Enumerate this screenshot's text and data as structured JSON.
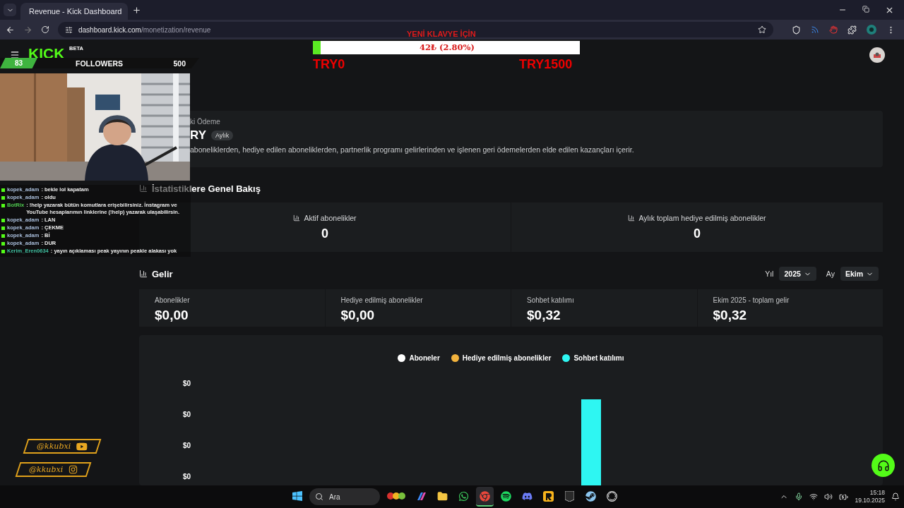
{
  "browser": {
    "tab": {
      "title": "Revenue - Kick Dashboard",
      "selected": true
    },
    "url_host": "dashboard.kick.com",
    "url_path": "/monetization/revenue"
  },
  "stream_overlay": {
    "logo": "KICK",
    "logo_tag": "BETA",
    "followers": {
      "count": "83",
      "label": "FOLLOWERS",
      "goal": "500"
    },
    "chat": [
      {
        "user": "kopek_adam",
        "text": ": bekle lol kapatam",
        "color": "#a9bedb"
      },
      {
        "user": "kopek_adam",
        "text": ": oldu",
        "color": "#a9bedb"
      },
      {
        "user": "BotRix",
        "text": ": !help yazarak bütün komutlara erişebilirsiniz. İnstagram ve YouTube hesaplarımın linklerine (!help) yazarak ulaşabilirsin.",
        "color": "#4fc94f"
      },
      {
        "user": "kopek_adam",
        "text": ": LAN",
        "color": "#a9bedb"
      },
      {
        "user": "kopek_adam",
        "text": ": ÇEKME",
        "color": "#a9bedb"
      },
      {
        "user": "kopek_adam",
        "text": ": Bİ",
        "color": "#a9bedb"
      },
      {
        "user": "kopek_adam",
        "text": ": DUR",
        "color": "#a9bedb"
      },
      {
        "user": "Kerim_Eren0634",
        "text": ": yayın açıklaması peak yayının peakle alakası yok",
        "color": "#3fbfa0"
      }
    ],
    "socials": [
      {
        "handle": "@kkubxi",
        "kind": "youtube"
      },
      {
        "handle": "@kkubxi",
        "kind": "instagram"
      }
    ],
    "donation_goal": {
      "title": "YENİ KLAVYE İÇİN",
      "reading": "42₺ (2.80%)",
      "level": 0.028,
      "min": "TRY0",
      "max": "TRY1500"
    }
  },
  "payout": {
    "label": "ki Ödeme",
    "amount": "RY",
    "period": "Aylık",
    "description": "aboneliklerden, hediye edilen aboneliklerden, partnerlik programı gelirlerinden ve işlenen geri ödemelerden elde edilen kazançları içerir."
  },
  "stats": {
    "title": "İstatistiklere Genel Bakış",
    "cards": [
      {
        "label": "Aktif abonelikler",
        "value": "0"
      },
      {
        "label": "Aylık toplam hediye edilmiş abonelikler",
        "value": "0"
      }
    ]
  },
  "revenue": {
    "title": "Gelir",
    "filters": [
      {
        "label": "Yıl",
        "value": "2025"
      },
      {
        "label": "Ay",
        "value": "Ekim"
      }
    ],
    "cards": [
      {
        "label": "Abonelikler",
        "value": "$0,00"
      },
      {
        "label": "Hediye edilmiş abonelikler",
        "value": "$0,00"
      },
      {
        "label": "Sohbet katılımı",
        "value": "$0,32"
      },
      {
        "label": "Ekim 2025 - toplam gelir",
        "value": "$0,32"
      }
    ],
    "chart": {
      "legend": [
        {
          "label": "Aboneler",
          "color": "#ffffff"
        },
        {
          "label": "Hediye edilmiş abonelikler",
          "color": "#f2b33d"
        },
        {
          "label": "Sohbet katılımı",
          "color": "#2ef6f2"
        }
      ],
      "y_labels": [
        "$0",
        "$0",
        "$0",
        "$0"
      ]
    }
  },
  "taskbar": {
    "search_placeholder": "Ara",
    "apps": [
      {
        "kind": "fruits",
        "selected": false
      },
      {
        "kind": "copilot",
        "selected": false
      },
      {
        "kind": "files",
        "selected": false
      },
      {
        "kind": "whatsapp",
        "selected": false
      },
      {
        "kind": "chrome",
        "selected": true
      },
      {
        "kind": "spotify",
        "selected": false
      },
      {
        "kind": "discord",
        "selected": false
      },
      {
        "kind": "rockstar",
        "selected": false
      },
      {
        "kind": "epic",
        "selected": false
      },
      {
        "kind": "steam",
        "selected": false
      },
      {
        "kind": "obs",
        "selected": false
      }
    ],
    "time": "15:18",
    "date": "19.10.2025"
  }
}
